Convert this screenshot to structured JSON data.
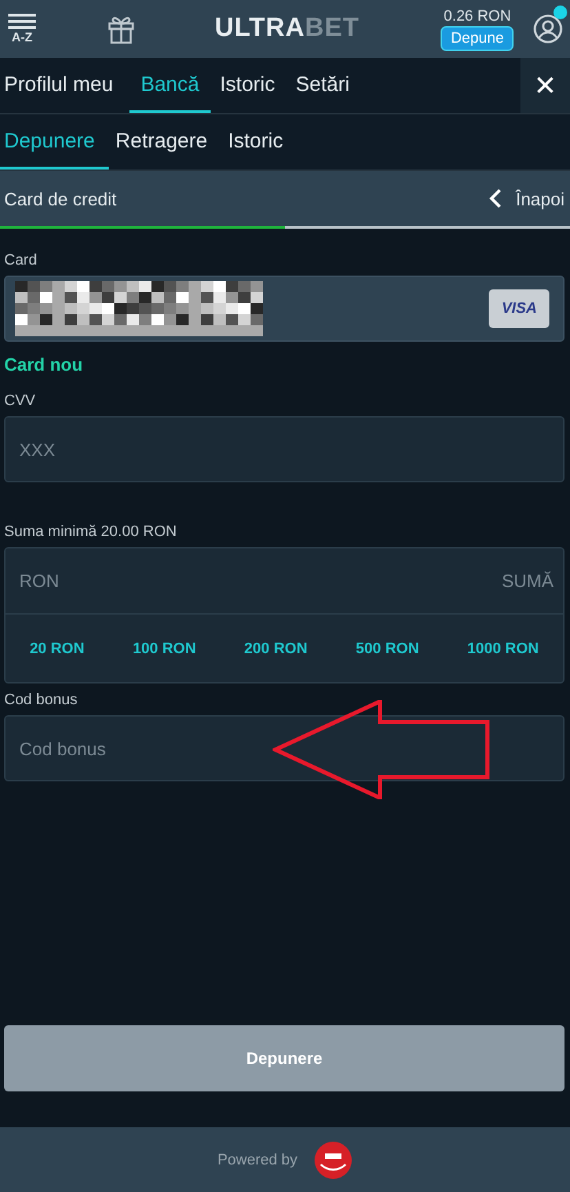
{
  "header": {
    "menu_label": "A-Z",
    "logo_primary": "ULTRA",
    "logo_secondary": "BET",
    "balance": "0.26 RON",
    "deposit_button": "Depune",
    "notification_badge": true
  },
  "tabs": [
    {
      "label": "Profilul meu",
      "selected": false
    },
    {
      "label": "Bancă",
      "selected": true
    },
    {
      "label": "Istoric",
      "selected": false
    },
    {
      "label": "Setări",
      "selected": false
    }
  ],
  "close_label": "✕",
  "subtabs": [
    {
      "label": "Depunere",
      "selected": true
    },
    {
      "label": "Retragere",
      "selected": false
    },
    {
      "label": "Istoric",
      "selected": false
    }
  ],
  "section": {
    "title": "Card de credit",
    "back_label": "Înapoi",
    "level": 0.5
  },
  "card": {
    "label": "Card",
    "brand": "VISA",
    "new_card_link": "Card nou"
  },
  "cvv": {
    "label": "CVV",
    "placeholder": "XXX"
  },
  "amount": {
    "label": "Suma minimă 20.00 RON",
    "currency": "RON",
    "placeholder": "SUMĂ",
    "presets": [
      "20 RON",
      "100 RON",
      "200 RON",
      "500 RON",
      "1000 RON"
    ]
  },
  "bonus": {
    "label": "Cod bonus",
    "placeholder": "Cod bonus"
  },
  "submit": {
    "label": "Depunere",
    "disabled": true
  },
  "footer": {
    "powered_by": "Powered by"
  }
}
